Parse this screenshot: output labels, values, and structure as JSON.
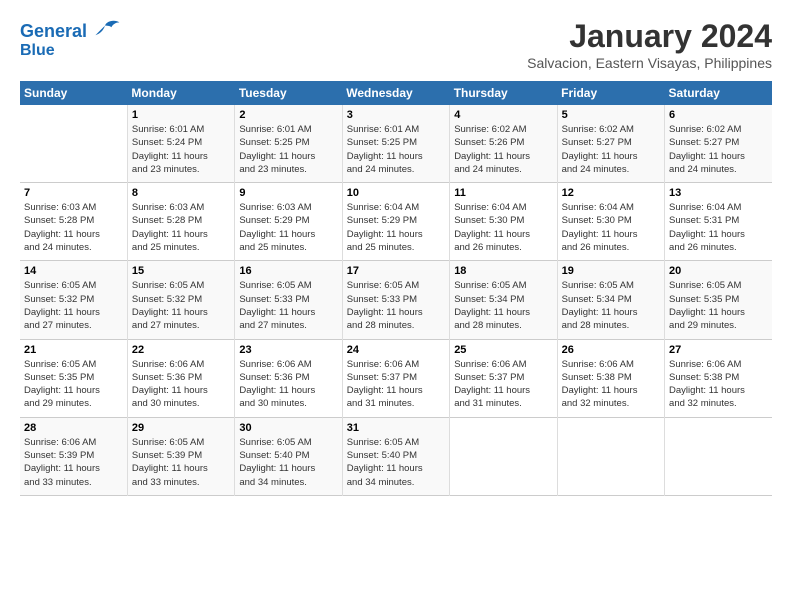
{
  "logo": {
    "line1": "General",
    "line2": "Blue"
  },
  "title": "January 2024",
  "subtitle": "Salvacion, Eastern Visayas, Philippines",
  "days_of_week": [
    "Sunday",
    "Monday",
    "Tuesday",
    "Wednesday",
    "Thursday",
    "Friday",
    "Saturday"
  ],
  "weeks": [
    [
      {
        "num": "",
        "info": ""
      },
      {
        "num": "1",
        "info": "Sunrise: 6:01 AM\nSunset: 5:24 PM\nDaylight: 11 hours\nand 23 minutes."
      },
      {
        "num": "2",
        "info": "Sunrise: 6:01 AM\nSunset: 5:25 PM\nDaylight: 11 hours\nand 23 minutes."
      },
      {
        "num": "3",
        "info": "Sunrise: 6:01 AM\nSunset: 5:25 PM\nDaylight: 11 hours\nand 24 minutes."
      },
      {
        "num": "4",
        "info": "Sunrise: 6:02 AM\nSunset: 5:26 PM\nDaylight: 11 hours\nand 24 minutes."
      },
      {
        "num": "5",
        "info": "Sunrise: 6:02 AM\nSunset: 5:27 PM\nDaylight: 11 hours\nand 24 minutes."
      },
      {
        "num": "6",
        "info": "Sunrise: 6:02 AM\nSunset: 5:27 PM\nDaylight: 11 hours\nand 24 minutes."
      }
    ],
    [
      {
        "num": "7",
        "info": "Sunrise: 6:03 AM\nSunset: 5:28 PM\nDaylight: 11 hours\nand 24 minutes."
      },
      {
        "num": "8",
        "info": "Sunrise: 6:03 AM\nSunset: 5:28 PM\nDaylight: 11 hours\nand 25 minutes."
      },
      {
        "num": "9",
        "info": "Sunrise: 6:03 AM\nSunset: 5:29 PM\nDaylight: 11 hours\nand 25 minutes."
      },
      {
        "num": "10",
        "info": "Sunrise: 6:04 AM\nSunset: 5:29 PM\nDaylight: 11 hours\nand 25 minutes."
      },
      {
        "num": "11",
        "info": "Sunrise: 6:04 AM\nSunset: 5:30 PM\nDaylight: 11 hours\nand 26 minutes."
      },
      {
        "num": "12",
        "info": "Sunrise: 6:04 AM\nSunset: 5:30 PM\nDaylight: 11 hours\nand 26 minutes."
      },
      {
        "num": "13",
        "info": "Sunrise: 6:04 AM\nSunset: 5:31 PM\nDaylight: 11 hours\nand 26 minutes."
      }
    ],
    [
      {
        "num": "14",
        "info": "Sunrise: 6:05 AM\nSunset: 5:32 PM\nDaylight: 11 hours\nand 27 minutes."
      },
      {
        "num": "15",
        "info": "Sunrise: 6:05 AM\nSunset: 5:32 PM\nDaylight: 11 hours\nand 27 minutes."
      },
      {
        "num": "16",
        "info": "Sunrise: 6:05 AM\nSunset: 5:33 PM\nDaylight: 11 hours\nand 27 minutes."
      },
      {
        "num": "17",
        "info": "Sunrise: 6:05 AM\nSunset: 5:33 PM\nDaylight: 11 hours\nand 28 minutes."
      },
      {
        "num": "18",
        "info": "Sunrise: 6:05 AM\nSunset: 5:34 PM\nDaylight: 11 hours\nand 28 minutes."
      },
      {
        "num": "19",
        "info": "Sunrise: 6:05 AM\nSunset: 5:34 PM\nDaylight: 11 hours\nand 28 minutes."
      },
      {
        "num": "20",
        "info": "Sunrise: 6:05 AM\nSunset: 5:35 PM\nDaylight: 11 hours\nand 29 minutes."
      }
    ],
    [
      {
        "num": "21",
        "info": "Sunrise: 6:05 AM\nSunset: 5:35 PM\nDaylight: 11 hours\nand 29 minutes."
      },
      {
        "num": "22",
        "info": "Sunrise: 6:06 AM\nSunset: 5:36 PM\nDaylight: 11 hours\nand 30 minutes."
      },
      {
        "num": "23",
        "info": "Sunrise: 6:06 AM\nSunset: 5:36 PM\nDaylight: 11 hours\nand 30 minutes."
      },
      {
        "num": "24",
        "info": "Sunrise: 6:06 AM\nSunset: 5:37 PM\nDaylight: 11 hours\nand 31 minutes."
      },
      {
        "num": "25",
        "info": "Sunrise: 6:06 AM\nSunset: 5:37 PM\nDaylight: 11 hours\nand 31 minutes."
      },
      {
        "num": "26",
        "info": "Sunrise: 6:06 AM\nSunset: 5:38 PM\nDaylight: 11 hours\nand 32 minutes."
      },
      {
        "num": "27",
        "info": "Sunrise: 6:06 AM\nSunset: 5:38 PM\nDaylight: 11 hours\nand 32 minutes."
      }
    ],
    [
      {
        "num": "28",
        "info": "Sunrise: 6:06 AM\nSunset: 5:39 PM\nDaylight: 11 hours\nand 33 minutes."
      },
      {
        "num": "29",
        "info": "Sunrise: 6:05 AM\nSunset: 5:39 PM\nDaylight: 11 hours\nand 33 minutes."
      },
      {
        "num": "30",
        "info": "Sunrise: 6:05 AM\nSunset: 5:40 PM\nDaylight: 11 hours\nand 34 minutes."
      },
      {
        "num": "31",
        "info": "Sunrise: 6:05 AM\nSunset: 5:40 PM\nDaylight: 11 hours\nand 34 minutes."
      },
      {
        "num": "",
        "info": ""
      },
      {
        "num": "",
        "info": ""
      },
      {
        "num": "",
        "info": ""
      }
    ]
  ]
}
